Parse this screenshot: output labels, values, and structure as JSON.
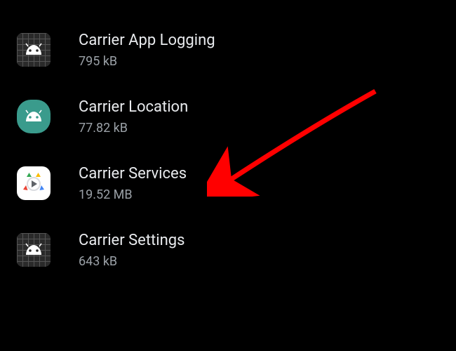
{
  "apps": [
    {
      "name": "Carrier App Logging",
      "size": "795 kB",
      "icon": "android-grid-icon"
    },
    {
      "name": "Carrier Location",
      "size": "77.82 kB",
      "icon": "android-teal-icon"
    },
    {
      "name": "Carrier Services",
      "size": "19.52 MB",
      "icon": "play-services-icon"
    },
    {
      "name": "Carrier Settings",
      "size": "643 kB",
      "icon": "android-grid-icon"
    }
  ],
  "annotation": {
    "target": "Carrier Services"
  }
}
